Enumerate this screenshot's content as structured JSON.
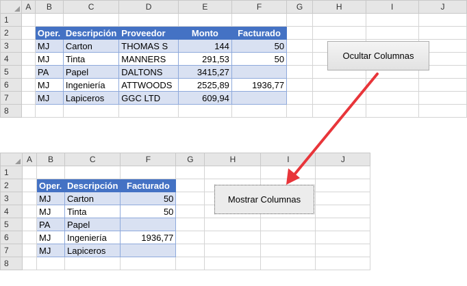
{
  "top_sheet": {
    "columns": [
      "A",
      "B",
      "C",
      "D",
      "E",
      "F",
      "G",
      "H",
      "I",
      "J"
    ],
    "rows": [
      "1",
      "2",
      "3",
      "4",
      "5",
      "6",
      "7",
      "8"
    ],
    "headers": [
      "Oper.",
      "Descripción",
      "Proveedor",
      "Monto",
      "Facturado"
    ],
    "data": [
      [
        "MJ",
        "Carton",
        "THOMAS S",
        "144",
        "50"
      ],
      [
        "MJ",
        "Tinta",
        "MANNERS",
        "291,53",
        "50"
      ],
      [
        "PA",
        "Papel",
        "DALTONS",
        "3415,27",
        ""
      ],
      [
        "MJ",
        "Ingeniería",
        "ATTWOODS",
        "2525,89",
        "1936,77"
      ],
      [
        "MJ",
        "Lapiceros",
        "GGC LTD",
        "609,94",
        ""
      ]
    ],
    "button_label": "Ocultar Columnas"
  },
  "bottom_sheet": {
    "columns": [
      "A",
      "B",
      "C",
      "F",
      "G",
      "H",
      "I",
      "J"
    ],
    "rows": [
      "1",
      "2",
      "3",
      "4",
      "5",
      "6",
      "7",
      "8"
    ],
    "headers": [
      "Oper.",
      "Descripción",
      "Facturado"
    ],
    "data": [
      [
        "MJ",
        "Carton",
        "50"
      ],
      [
        "MJ",
        "Tinta",
        "50"
      ],
      [
        "PA",
        "Papel",
        ""
      ],
      [
        "MJ",
        "Ingeniería",
        "1936,77"
      ],
      [
        "MJ",
        "Lapiceros",
        ""
      ]
    ],
    "button_label": "Mostrar Columnas"
  },
  "colors": {
    "table_header": "#4472c4",
    "band_row": "#d9e1f2",
    "arrow": "#e8353a"
  }
}
